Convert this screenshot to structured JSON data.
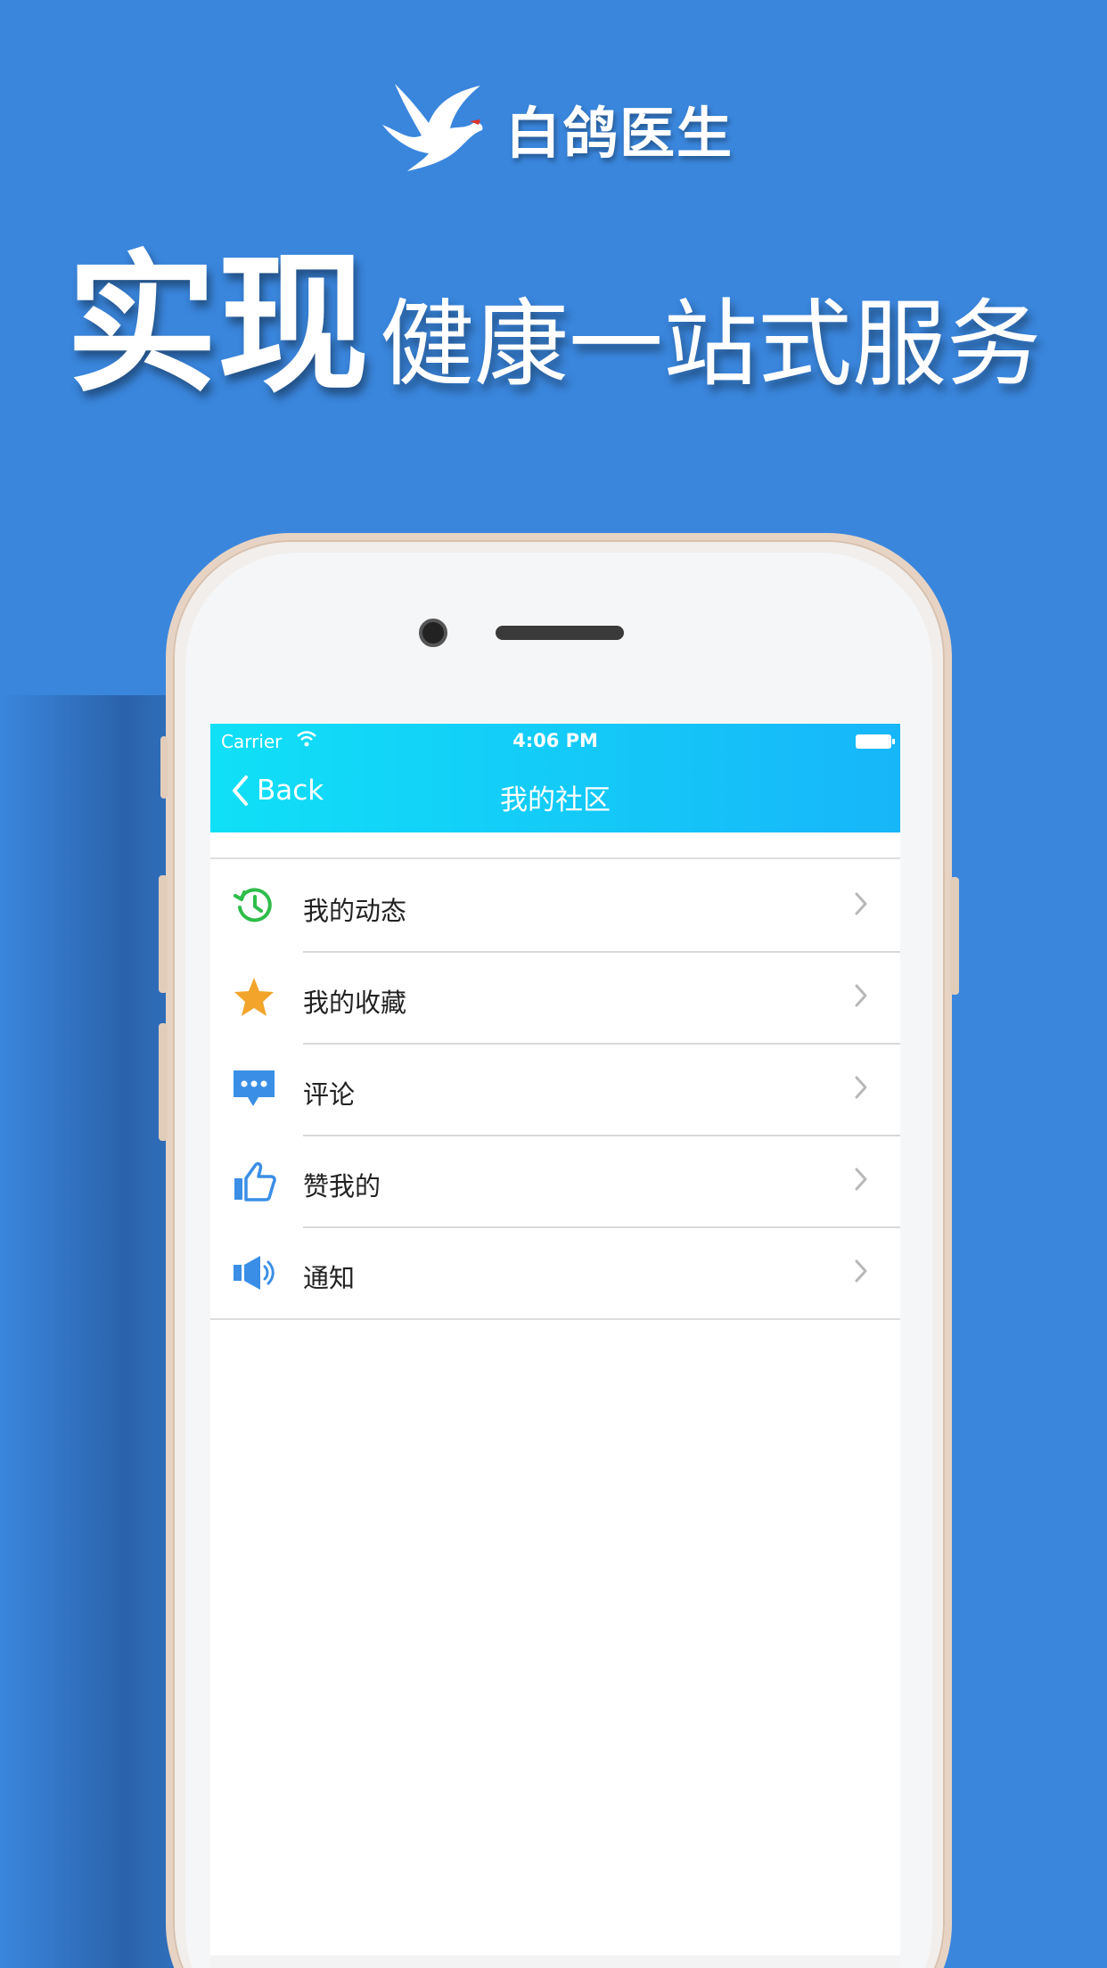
{
  "brand": {
    "name": "白鸽医生"
  },
  "headline": {
    "big": "实现",
    "small": "健康一站式服务"
  },
  "status_bar": {
    "carrier": "Carrier",
    "time": "4:06 PM"
  },
  "nav": {
    "back_label": "Back",
    "title": "我的社区"
  },
  "menu": {
    "items": [
      {
        "label": "我的动态",
        "icon": "history-clock-icon",
        "color": "#2ebd4a"
      },
      {
        "label": "我的收藏",
        "icon": "star-icon",
        "color": "#f2a42b"
      },
      {
        "label": "评论",
        "icon": "comment-bubble-icon",
        "color": "#3a8ee6"
      },
      {
        "label": "赞我的",
        "icon": "thumbs-up-icon",
        "color": "#3a8ee6"
      },
      {
        "label": "通知",
        "icon": "speaker-icon",
        "color": "#3a8ee6"
      }
    ]
  },
  "colors": {
    "background": "#3a86dd",
    "navbar_start": "#10e0f7",
    "navbar_end": "#17b6f9"
  }
}
